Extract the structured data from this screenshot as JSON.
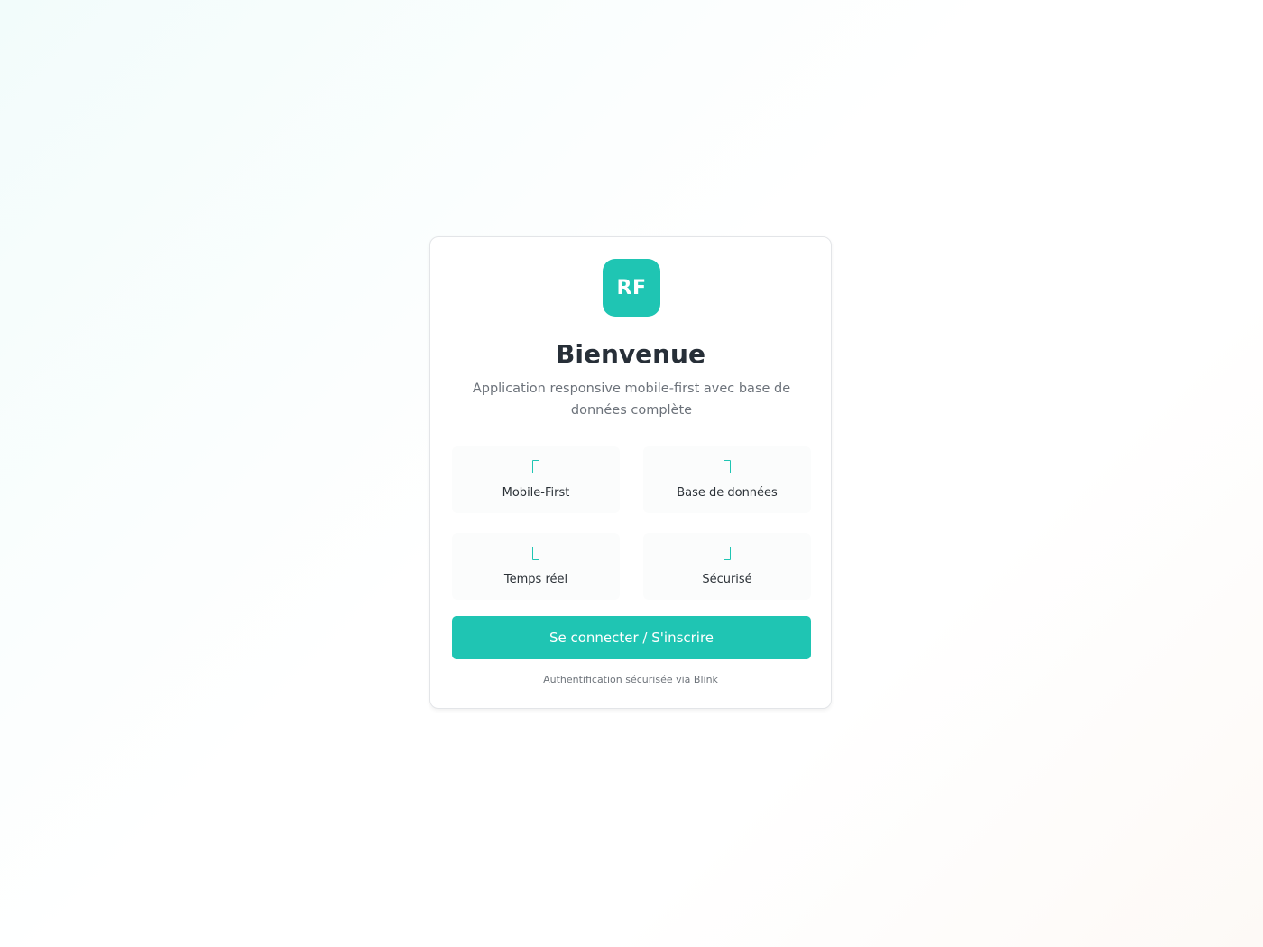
{
  "colors": {
    "accent": "#1fc5b3"
  },
  "card": {
    "logo_text": "RF",
    "title": "Bienvenue",
    "subtitle": "Application responsive mobile-first avec base de données complète",
    "features": [
      {
        "label": "Mobile-First",
        "icon": "mobile-icon"
      },
      {
        "label": "Base de données",
        "icon": "database-icon"
      },
      {
        "label": "Temps réel",
        "icon": "realtime-icon"
      },
      {
        "label": "Sécurisé",
        "icon": "lock-icon"
      }
    ],
    "cta_label": "Se connecter / S'inscrire",
    "footnote": "Authentification sécurisée via Blink"
  }
}
